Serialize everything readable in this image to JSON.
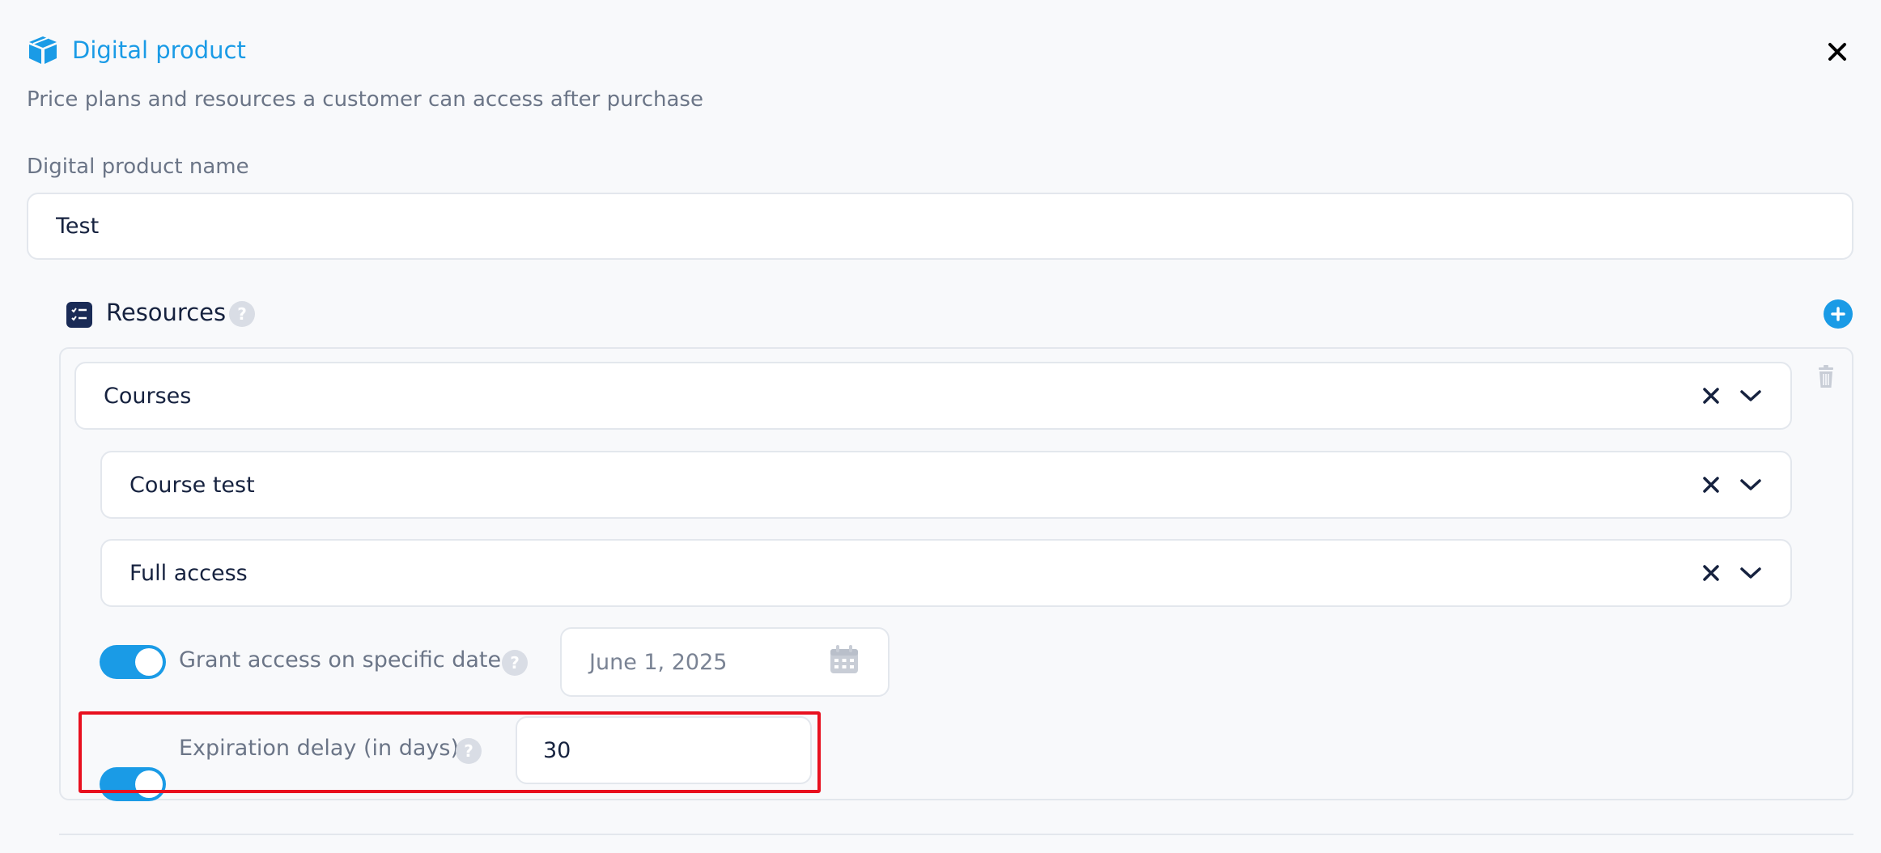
{
  "header": {
    "title": "Digital product",
    "subtitle": "Price plans and resources a customer can access after purchase",
    "icon": "box-icon",
    "close_icon": "close-icon"
  },
  "product_name": {
    "label": "Digital product name",
    "value": "Test"
  },
  "resources": {
    "title": "Resources",
    "help": "?",
    "resource_type": "Courses",
    "course": "Course test",
    "access_level": "Full access",
    "grant_access": {
      "label": "Grant access on specific date",
      "enabled": true,
      "date": "June 1, 2025"
    },
    "expiration": {
      "label": "Expiration delay (in days)",
      "enabled": true,
      "days": "30"
    }
  },
  "colors": {
    "accent": "#1a9be6",
    "text": "#16223f",
    "muted": "#6b7587",
    "highlight": "#e8101f"
  }
}
